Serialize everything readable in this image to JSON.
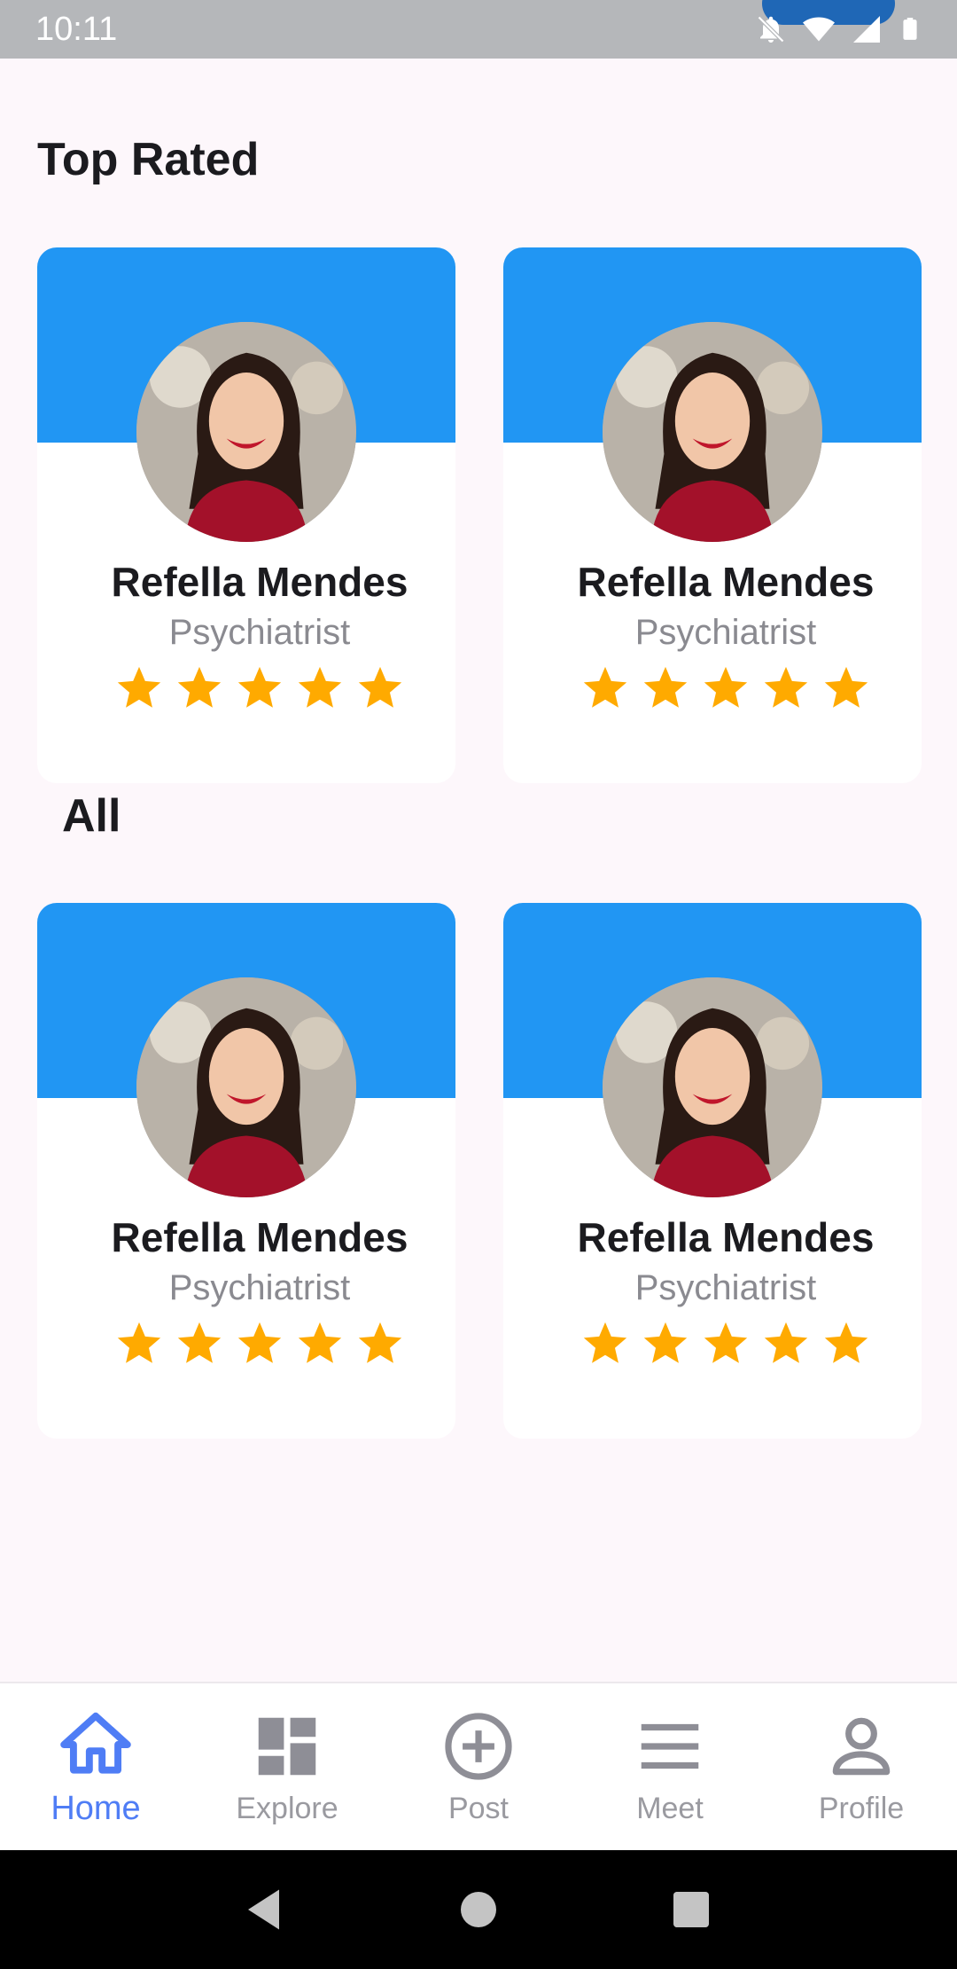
{
  "status_bar": {
    "time": "10:11"
  },
  "sections": {
    "top_rated": "Top Rated",
    "all": "All"
  },
  "cards": {
    "top_rated": [
      {
        "name": "Refella Mendes",
        "role": "Psychiatrist",
        "rating": 5
      },
      {
        "name": "Refella Mendes",
        "role": "Psychiatrist",
        "rating": 5
      }
    ],
    "all": [
      {
        "name": "Refella Mendes",
        "role": "Psychiatrist",
        "rating": 5
      },
      {
        "name": "Refella Mendes",
        "role": "Psychiatrist",
        "rating": 5
      }
    ]
  },
  "bottom_nav": {
    "items": [
      {
        "label": "Home",
        "icon": "home-icon",
        "active": true
      },
      {
        "label": "Explore",
        "icon": "dashboard-icon",
        "active": false
      },
      {
        "label": "Post",
        "icon": "add-circle-icon",
        "active": false
      },
      {
        "label": "Meet",
        "icon": "menu-icon",
        "active": false
      },
      {
        "label": "Profile",
        "icon": "person-icon",
        "active": false
      }
    ]
  },
  "colors": {
    "accent": "#2196f3",
    "active_nav": "#4f7df5",
    "star": "#ffaa00",
    "background": "#fdf7fb"
  }
}
